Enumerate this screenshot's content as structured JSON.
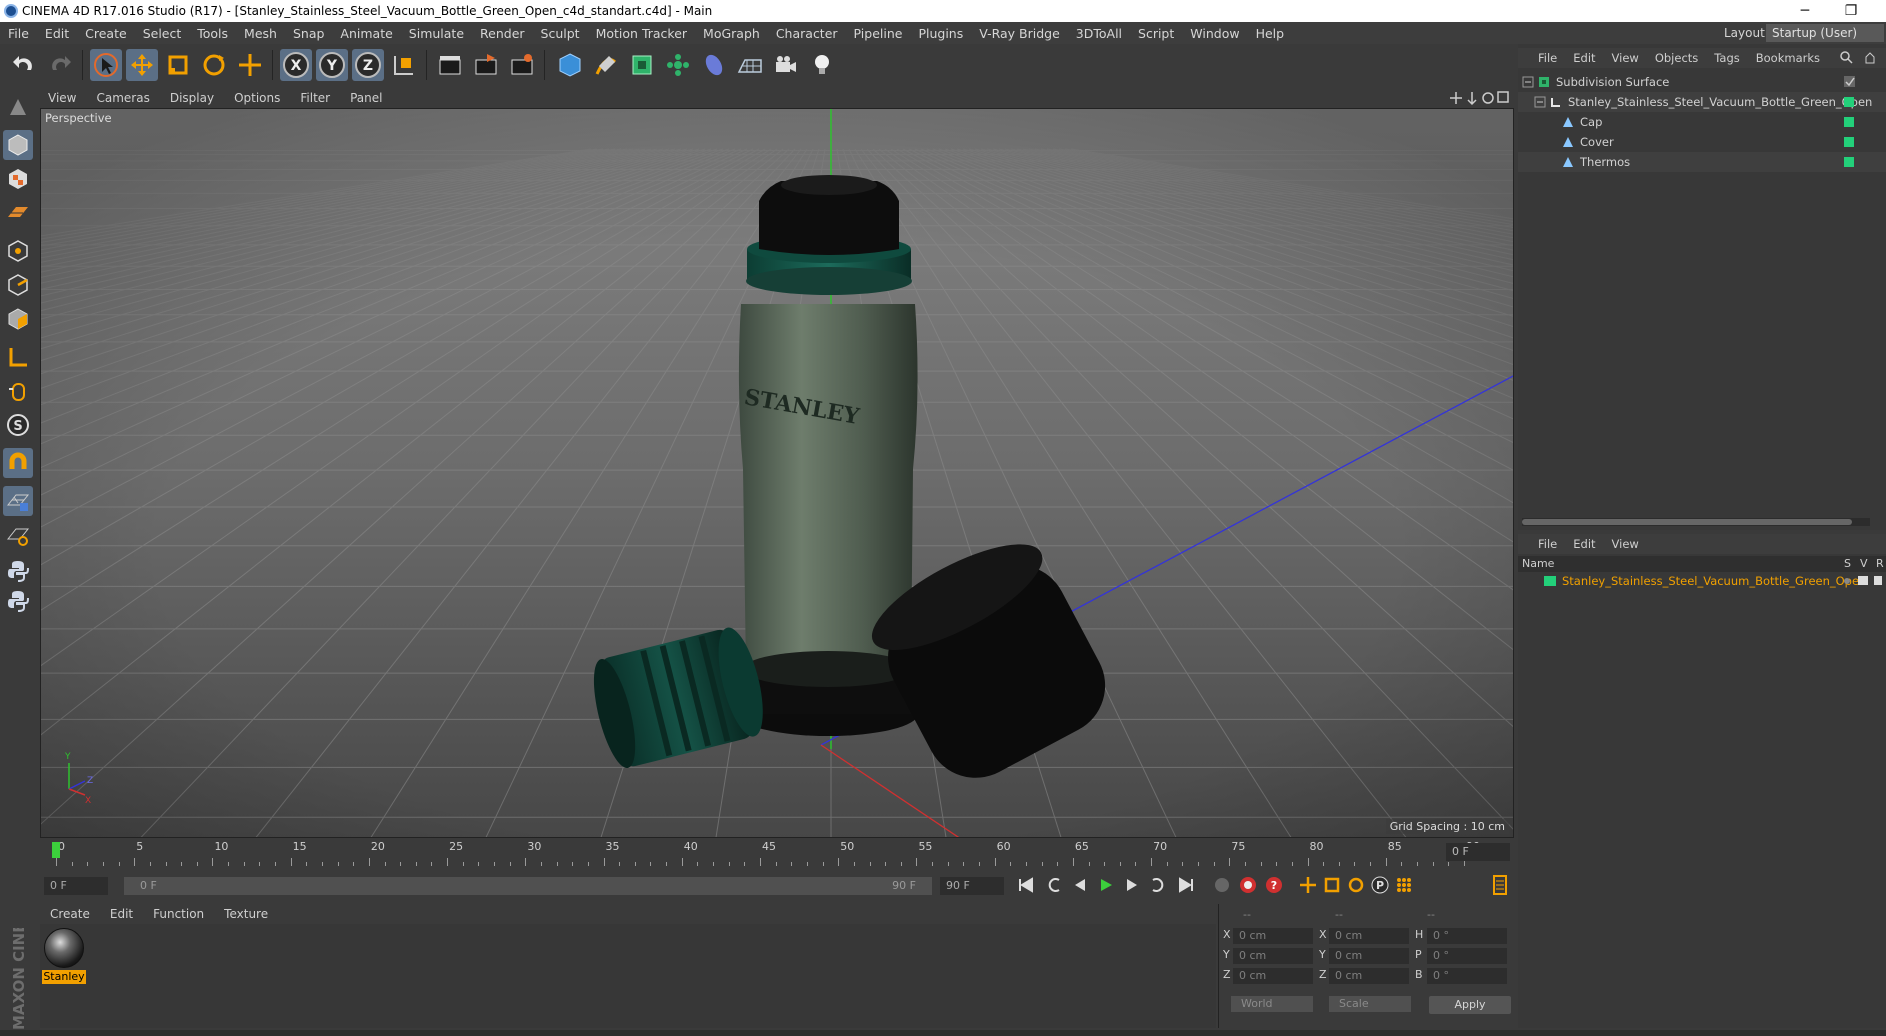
{
  "window": {
    "title": "CINEMA 4D R17.016 Studio (R17) - [Stanley_Stainless_Steel_Vacuum_Bottle_Green_Open_c4d_standart.c4d] - Main",
    "minimize": "─",
    "restore": "❐"
  },
  "menubar": {
    "items": [
      "File",
      "Edit",
      "Create",
      "Select",
      "Tools",
      "Mesh",
      "Snap",
      "Animate",
      "Simulate",
      "Render",
      "Sculpt",
      "Motion Tracker",
      "MoGraph",
      "Character",
      "Pipeline",
      "Plugins",
      "V-Ray Bridge",
      "3DToAll",
      "Script",
      "Window",
      "Help"
    ],
    "layout_label": "Layout:",
    "layout_value": "Startup (User)"
  },
  "viewport": {
    "menu": [
      "View",
      "Cameras",
      "Display",
      "Options",
      "Filter",
      "Panel"
    ],
    "label": "Perspective",
    "grid_spacing": "Grid Spacing : 10 cm",
    "axis_labels": [
      "Y",
      "Z",
      "X"
    ]
  },
  "timeline": {
    "ticks": [
      "0",
      "5",
      "10",
      "15",
      "20",
      "25",
      "30",
      "35",
      "40",
      "45",
      "50",
      "55",
      "60",
      "65",
      "70",
      "75",
      "80",
      "85",
      "90"
    ],
    "current_frame": "0 F"
  },
  "transport": {
    "start_field": "0 F",
    "range_start": "0 F",
    "range_end": "90 F",
    "end_field": "90 F"
  },
  "material_manager": {
    "menu": [
      "Create",
      "Edit",
      "Function",
      "Texture"
    ],
    "materials": [
      {
        "name": "Stanley"
      }
    ]
  },
  "maxon_label": "MAXON CINEMA 4D",
  "coordinates": {
    "header": [
      "--",
      "--",
      "--"
    ],
    "rows": [
      {
        "pos_label": "X",
        "pos": "0 cm",
        "size_label": "X",
        "size": "0 cm",
        "rot_label": "H",
        "rot": "0 °"
      },
      {
        "pos_label": "Y",
        "pos": "0 cm",
        "size_label": "Y",
        "size": "0 cm",
        "rot_label": "P",
        "rot": "0 °"
      },
      {
        "pos_label": "Z",
        "pos": "0 cm",
        "size_label": "Z",
        "size": "0 cm",
        "rot_label": "B",
        "rot": "0 °"
      }
    ],
    "mode": "World",
    "transform": "Scale",
    "apply": "Apply"
  },
  "object_manager": {
    "menu": [
      "File",
      "Edit",
      "View",
      "Objects",
      "Tags",
      "Bookmarks"
    ],
    "objects": [
      {
        "name": "Subdivision Surface",
        "indent": 0,
        "icon": "subdivision-icon"
      },
      {
        "name": "Stanley_Stainless_Steel_Vacuum_Bottle_Green_Open",
        "indent": 1,
        "icon": "null-icon"
      },
      {
        "name": "Cap",
        "indent": 2,
        "icon": "polygon-icon"
      },
      {
        "name": "Cover",
        "indent": 2,
        "icon": "polygon-icon"
      },
      {
        "name": "Thermos",
        "indent": 2,
        "icon": "polygon-icon"
      }
    ]
  },
  "layer_manager": {
    "menu": [
      "File",
      "Edit",
      "View"
    ],
    "columns": [
      "Name",
      "S",
      "V",
      "R"
    ],
    "layers": [
      {
        "name": "Stanley_Stainless_Steel_Vacuum_Bottle_Green_Open",
        "color": "#23d07a"
      }
    ]
  },
  "colors": {
    "accent": "#5b6f86",
    "tag_green": "#23d07a",
    "material_highlight": "#f2a000"
  }
}
